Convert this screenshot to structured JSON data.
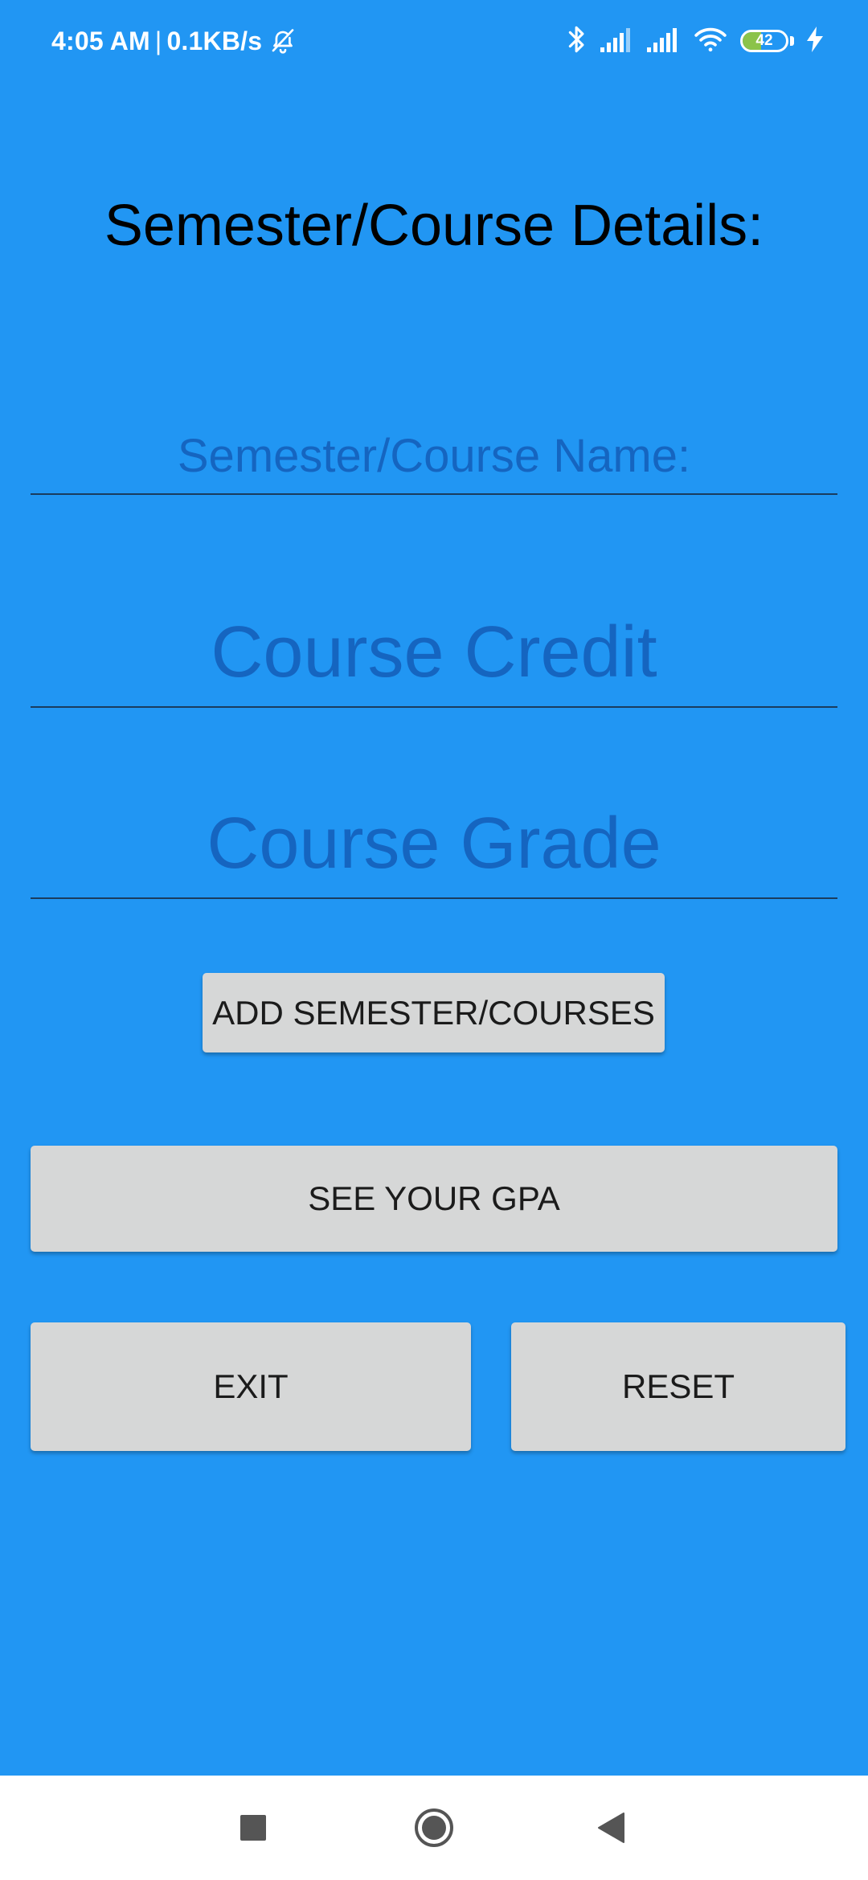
{
  "status_bar": {
    "time": "4:05 AM",
    "separator": "|",
    "speed": "0.1KB/s",
    "icons": [
      "bell-off-icon",
      "bluetooth-icon",
      "signal-icon",
      "signal-icon",
      "wifi-icon",
      "battery-icon",
      "charging-icon"
    ],
    "battery_level": "42",
    "battery_fraction": 0.42
  },
  "title": "Semester/Course Details:",
  "fields": {
    "name_placeholder": "Semester/Course Name:",
    "credit_placeholder": "Course Credit",
    "grade_placeholder": "Course Grade"
  },
  "buttons": {
    "add": "ADD SEMESTER/COURSES",
    "gpa": "SEE YOUR GPA",
    "exit": "EXIT",
    "reset": "RESET"
  },
  "nav_bar": {
    "icons": [
      "recents-square-icon",
      "home-circle-icon",
      "back-triangle-icon"
    ]
  },
  "colors": {
    "background": "#2196F3",
    "hint_text": "#1565C0",
    "button": "#D6D7D7",
    "battery_fill": "#8BC34A"
  }
}
